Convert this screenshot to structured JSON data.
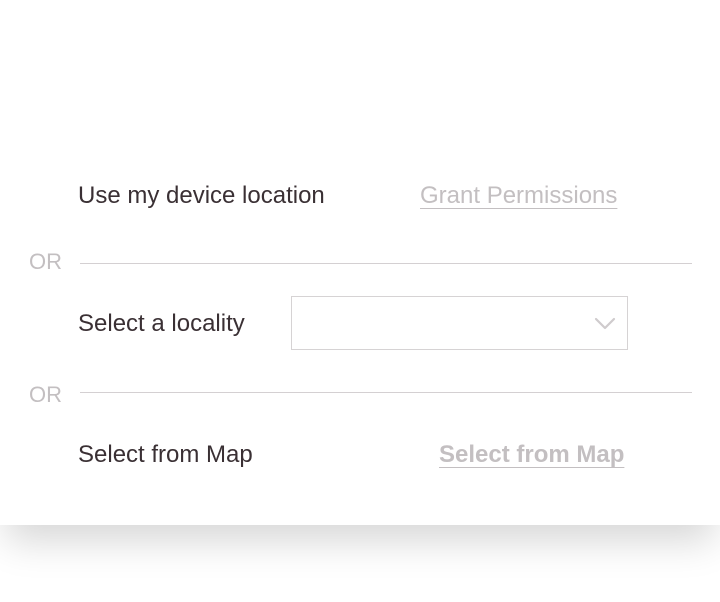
{
  "device_location": {
    "label": "Use my device location",
    "action_label": "Grant Permissions"
  },
  "separators": [
    "OR",
    "OR"
  ],
  "locality": {
    "label": "Select a locality",
    "selected_value": ""
  },
  "map": {
    "label": "Select from Map",
    "action_label": "Select from Map"
  },
  "colors": {
    "text": "#3a3034",
    "muted": "#c3bfc1",
    "divider": "#d4d0d2"
  },
  "icons": {
    "dropdown": "chevron-down-icon"
  }
}
